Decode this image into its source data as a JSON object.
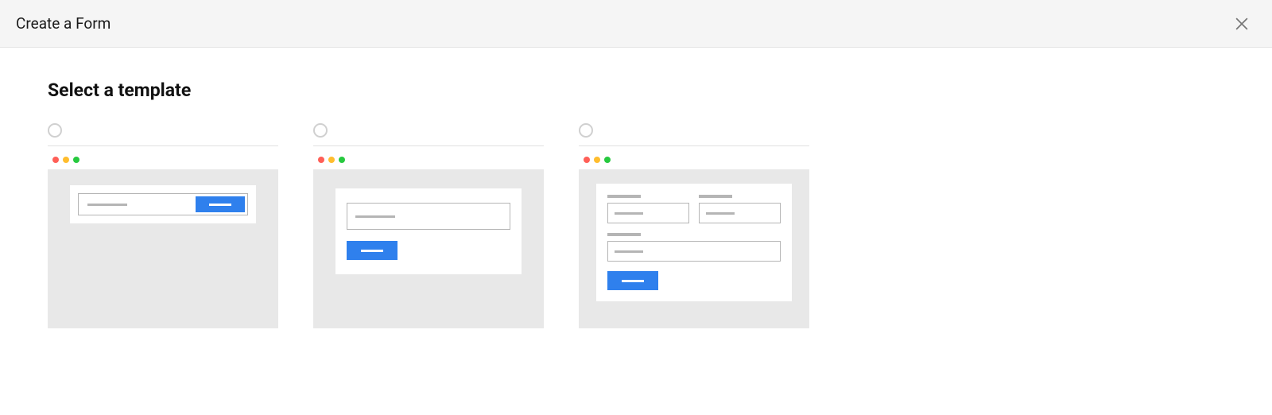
{
  "header": {
    "title": "Create a Form"
  },
  "section": {
    "title": "Select a template"
  },
  "templates": [
    {
      "id": "inline-newsletter",
      "selected": false
    },
    {
      "id": "newsletter",
      "selected": false
    },
    {
      "id": "simple-contact",
      "selected": false
    }
  ],
  "colors": {
    "accent_button": "#2f80ed",
    "chrome_red": "#ff5f57",
    "chrome_yellow": "#ffbd2e",
    "chrome_green": "#27c93f"
  }
}
